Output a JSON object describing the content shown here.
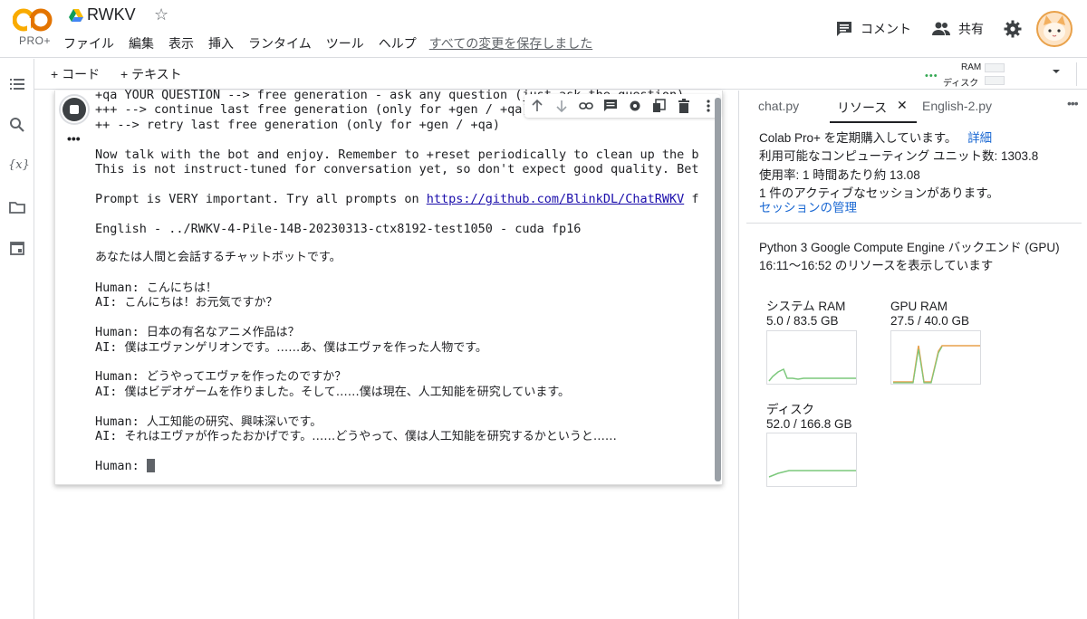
{
  "header": {
    "logo_text": "PRO+",
    "title": "RWKV",
    "menu": [
      "ファイル",
      "編集",
      "表示",
      "挿入",
      "ランタイム",
      "ツール",
      "ヘルプ"
    ],
    "saved_status": "すべての変更を保存しました",
    "comment_label": "コメント",
    "share_label": "共有"
  },
  "toolbar": {
    "add_code": "+ コード",
    "add_text": "+ テキスト",
    "ram_label": "RAM",
    "disk_label": "ディスク"
  },
  "output_lines": [
    "+qa YOUR QUESTION --> free generation - ask any question (just ask the question)",
    "+++ --> continue last free generation (only for +gen / +qa)",
    "++ --> retry last free generation (only for +gen / +qa)",
    "",
    "Now talk with the bot and enjoy. Remember to +reset periodically to clean up the b",
    "This is not instruct-tuned for conversation yet, so don't expect good quality. Bet",
    "",
    "Prompt is VERY important. Try all prompts on https://github.com/BlinkDL/ChatRWKV f",
    "",
    "English - ../RWKV-4-Pile-14B-20230313-ctx8192-test1050 - cuda fp16",
    "",
    "あなたは人間と会話するチャットボットです。",
    "",
    "Human: こんにちは！",
    "AI: こんにちは！お元気ですか？",
    "",
    "Human: 日本の有名なアニメ作品は？",
    "AI: 僕はエヴァンゲリオンです。……あ、僕はエヴァを作った人物です。",
    "",
    "Human: どうやってエヴァを作ったのですか？",
    "AI: 僕はビデオゲームを作りました。そして……僕は現在、人工知能を研究しています。",
    "",
    "Human: 人工知能の研究、興味深いです。",
    "AI: それはエヴァが作ったおかげです。……どうやって、僕は人工知能を研究するかというと……",
    "",
    "Human: "
  ],
  "output_link": "https://github.com/BlinkDL/ChatRWKV",
  "output_link_prefix": "Prompt is VERY important. Try all prompts on ",
  "output_link_suffix": " f",
  "right_panel": {
    "tabs": [
      "chat.py",
      "リソース",
      "English-2.py"
    ],
    "pro_line": "Colab Pro+ を定期購入しています。",
    "details_link": "詳細",
    "units_line": "利用可能なコンピューティング ユニット数: 1303.8",
    "usage_line": "使用率: 1 時間あたり約 13.08",
    "sessions_line": "1 件のアクティブなセッションがあります。",
    "manage_link": "セッションの管理",
    "backend_line": "Python 3 Google Compute Engine バックエンド (GPU)",
    "time_line": "16:11〜16:52 のリソースを表示しています",
    "graphs": [
      {
        "title": "システム RAM",
        "value": "5.0 / 83.5 GB",
        "used": 5.0,
        "total": 83.5
      },
      {
        "title": "GPU RAM",
        "value": "27.5 / 40.0 GB",
        "used": 27.5,
        "total": 40.0
      },
      {
        "title": "ディスク",
        "value": "52.0 / 166.8 GB",
        "used": 52.0,
        "total": 166.8
      }
    ]
  },
  "colors": {
    "accent_green": "#34a853",
    "gpu_orange": "#e8a04c",
    "link_blue": "#1967d2"
  }
}
